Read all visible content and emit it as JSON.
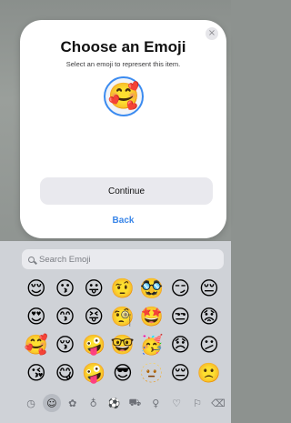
{
  "dialog": {
    "close_glyph": "×",
    "title": "Choose an Emoji",
    "subtitle": "Select an emoji to represent this item.",
    "selected_emoji": "🥰",
    "continue_label": "Continue",
    "back_label": "Back"
  },
  "keyboard": {
    "search_placeholder": "Search Emoji",
    "emojis": [
      "😌",
      "😗",
      "😛",
      "🤨",
      "🥸",
      "😏",
      "😔",
      "😍",
      "😙",
      "😝",
      "🧐",
      "🤩",
      "😒",
      "😟",
      "🥰",
      "😚",
      "🤪",
      "🤓",
      "🥳",
      "😞",
      "😕",
      "😘",
      "😋",
      "🤪",
      "😎",
      "🫥",
      "😔",
      "🙁"
    ],
    "categories": [
      {
        "name": "recent-icon",
        "glyph": "◷"
      },
      {
        "name": "smileys-icon",
        "glyph": "☺"
      },
      {
        "name": "animals-icon",
        "glyph": "✿"
      },
      {
        "name": "food-icon",
        "glyph": "♁"
      },
      {
        "name": "activity-icon",
        "glyph": "⚽"
      },
      {
        "name": "travel-icon",
        "glyph": "⛟"
      },
      {
        "name": "objects-icon",
        "glyph": "♀"
      },
      {
        "name": "symbols-icon",
        "glyph": "♡"
      },
      {
        "name": "flags-icon",
        "glyph": "⚐"
      },
      {
        "name": "delete-icon",
        "glyph": "⌫"
      }
    ],
    "active_category": 1
  },
  "colors": {
    "accent": "#3a86e8",
    "sheet_bg": "#ffffff",
    "keyboard_bg": "#cfd2d7"
  }
}
